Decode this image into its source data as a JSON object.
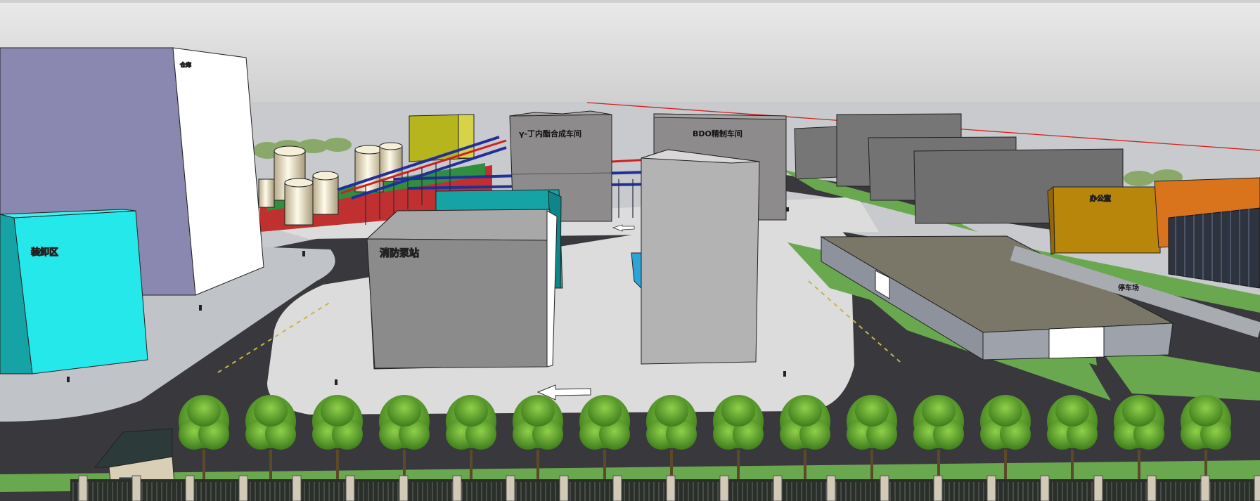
{
  "viewport": {
    "title": "",
    "background_sky": "#e6e6e6",
    "ground_color": "#c4c6c9",
    "road_color": "#3a3a3f",
    "grass_color": "#6aa84f"
  },
  "labels": {
    "building_storage": "装卸区",
    "building_fire_pump": "消防泵站",
    "building_gbl_synthesis": "γ-丁内酯合成车间",
    "building_bdo": "BDO精制车间",
    "building_office": "办公室",
    "tall_building_sign": "仓库",
    "road_label": "停车场"
  },
  "colors": {
    "cyan_block": "#25e8ea",
    "teal_block": "#16a3a6",
    "lavender_block": "#8a87b0",
    "yellow_block": "#b6b51e",
    "ochre_block": "#b8860b",
    "orange_block": "#d9731c",
    "gray_block": "#7d7d7d",
    "light_gray_block": "#b3b3b3",
    "tree_green": "#5fa22a",
    "pipe_red": "#d02020",
    "pipe_blue": "#20309a"
  }
}
